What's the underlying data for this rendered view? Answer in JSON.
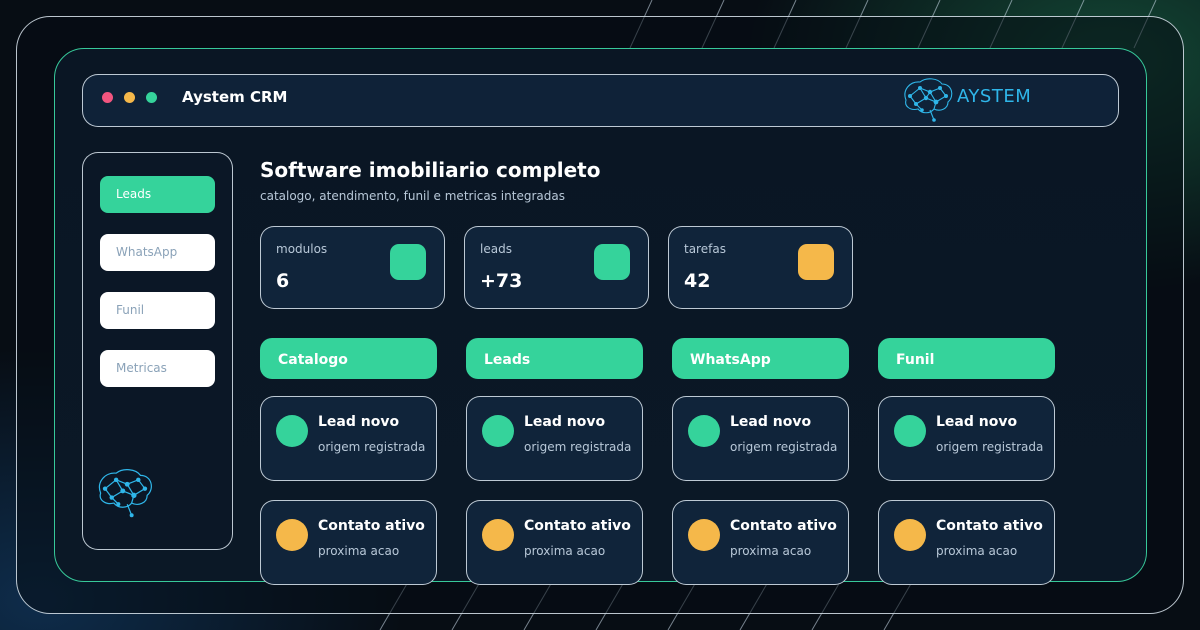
{
  "app": {
    "title": "Aystem CRM",
    "brand": "AYSTEM"
  },
  "window_controls": [
    {
      "name": "close",
      "color": "#f2557f"
    },
    {
      "name": "minimize",
      "color": "#f5b84a"
    },
    {
      "name": "maximize",
      "color": "#35d39b"
    }
  ],
  "sidebar": {
    "items": [
      {
        "label": "Leads",
        "active": true
      },
      {
        "label": "WhatsApp",
        "active": false
      },
      {
        "label": "Funil",
        "active": false
      },
      {
        "label": "Metricas",
        "active": false
      }
    ]
  },
  "header": {
    "title": "Software imobiliario completo",
    "subtitle": "catalogo, atendimento, funil e metricas integradas"
  },
  "stats": [
    {
      "label": "modulos",
      "value": "6",
      "color": "#35d39b"
    },
    {
      "label": "leads",
      "value": "+73",
      "color": "#35d39b"
    },
    {
      "label": "tarefas",
      "value": "42",
      "color": "#f5b84a"
    }
  ],
  "columns": [
    {
      "title": "Catalogo",
      "cards": [
        {
          "title": "Lead novo",
          "subtitle": "origem registrada",
          "color": "#35d39b"
        },
        {
          "title": "Contato ativo",
          "subtitle": "proxima acao",
          "color": "#f5b84a"
        }
      ]
    },
    {
      "title": "Leads",
      "cards": [
        {
          "title": "Lead novo",
          "subtitle": "origem registrada",
          "color": "#35d39b"
        },
        {
          "title": "Contato ativo",
          "subtitle": "proxima acao",
          "color": "#f5b84a"
        }
      ]
    },
    {
      "title": "WhatsApp",
      "cards": [
        {
          "title": "Lead novo",
          "subtitle": "origem registrada",
          "color": "#35d39b"
        },
        {
          "title": "Contato ativo",
          "subtitle": "proxima acao",
          "color": "#f5b84a"
        }
      ]
    },
    {
      "title": "Funil",
      "cards": [
        {
          "title": "Lead novo",
          "subtitle": "origem registrada",
          "color": "#35d39b"
        },
        {
          "title": "Contato ativo",
          "subtitle": "proxima acao",
          "color": "#f5b84a"
        }
      ]
    }
  ],
  "theme": {
    "accent": "#35d39b",
    "warning": "#f5b84a",
    "panel": "#10243a",
    "brand_blue": "#2fb6e9"
  },
  "icons": [
    "brain-network-logo-icon"
  ]
}
